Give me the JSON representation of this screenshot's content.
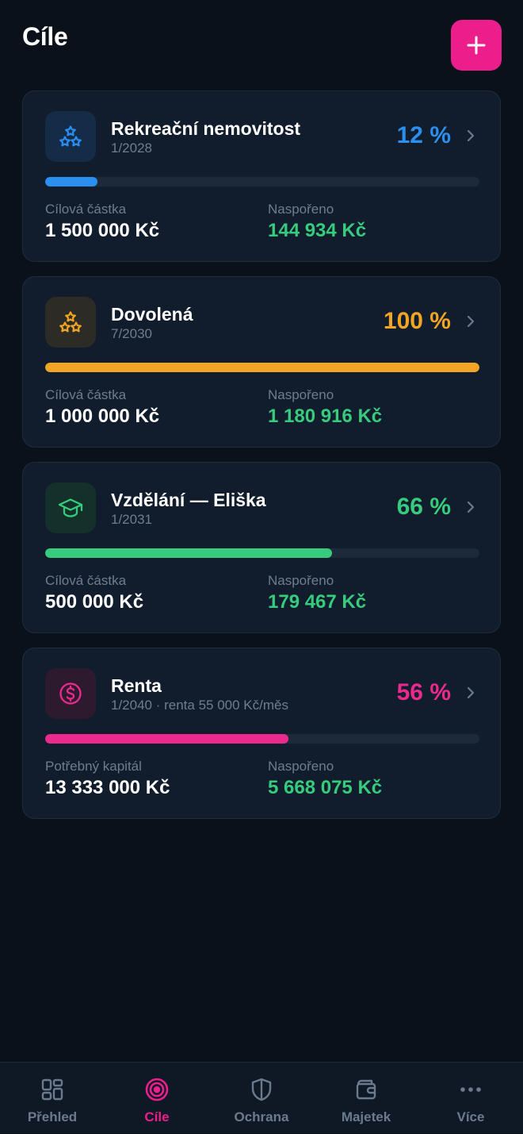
{
  "header": {
    "title": "Cíle",
    "add_icon": "plus-icon"
  },
  "goals": [
    {
      "name": "Rekreační nemovitost",
      "subtitle": "1/2028",
      "percent_label": "12 %",
      "progress": 0.12,
      "color": "#2b8ff0",
      "icon_bg": "#142c48",
      "icon": "stars-icon",
      "target_label": "Cílová částka",
      "target_value": "1 500 000 Kč",
      "saved_label": "Naspořeno",
      "saved_value": "144 934 Kč"
    },
    {
      "name": "Dovolená",
      "subtitle": "7/2030",
      "percent_label": "100 %",
      "progress": 1.0,
      "color": "#f2a524",
      "icon_bg": "#2c2b26",
      "icon": "stars-icon",
      "target_label": "Cílová částka",
      "target_value": "1 000 000 Kč",
      "saved_label": "Naspořeno",
      "saved_value": "1 180 916 Kč"
    },
    {
      "name": "Vzdělání — Eliška",
      "subtitle": "1/2031",
      "percent_label": "66 %",
      "progress": 0.66,
      "color": "#37cc7d",
      "icon_bg": "#13302a",
      "icon": "graduation-cap-icon",
      "target_label": "Cílová částka",
      "target_value": "500 000 Kč",
      "saved_label": "Naspořeno",
      "saved_value": "179 467 Kč"
    },
    {
      "name": "Renta",
      "subtitle": "1/2040 · renta 55 000 Kč/měs",
      "percent_label": "56 %",
      "progress": 0.56,
      "color": "#ec2a8e",
      "icon_bg": "#2e1a2e",
      "icon": "dollar-coin-icon",
      "target_label": "Potřebný kapitál",
      "target_value": "13 333 000 Kč",
      "saved_label": "Naspořeno",
      "saved_value": "5 668 075 Kč"
    }
  ],
  "nav": {
    "active": "Cíle",
    "active_color": "#ec1e8c",
    "items": [
      {
        "label": "Přehled",
        "icon": "dashboard-grid-icon"
      },
      {
        "label": "Cíle",
        "icon": "target-icon"
      },
      {
        "label": "Ochrana",
        "icon": "shield-icon"
      },
      {
        "label": "Majetek",
        "icon": "wallet-icon"
      },
      {
        "label": "Více",
        "icon": "more-dots-icon"
      }
    ]
  }
}
